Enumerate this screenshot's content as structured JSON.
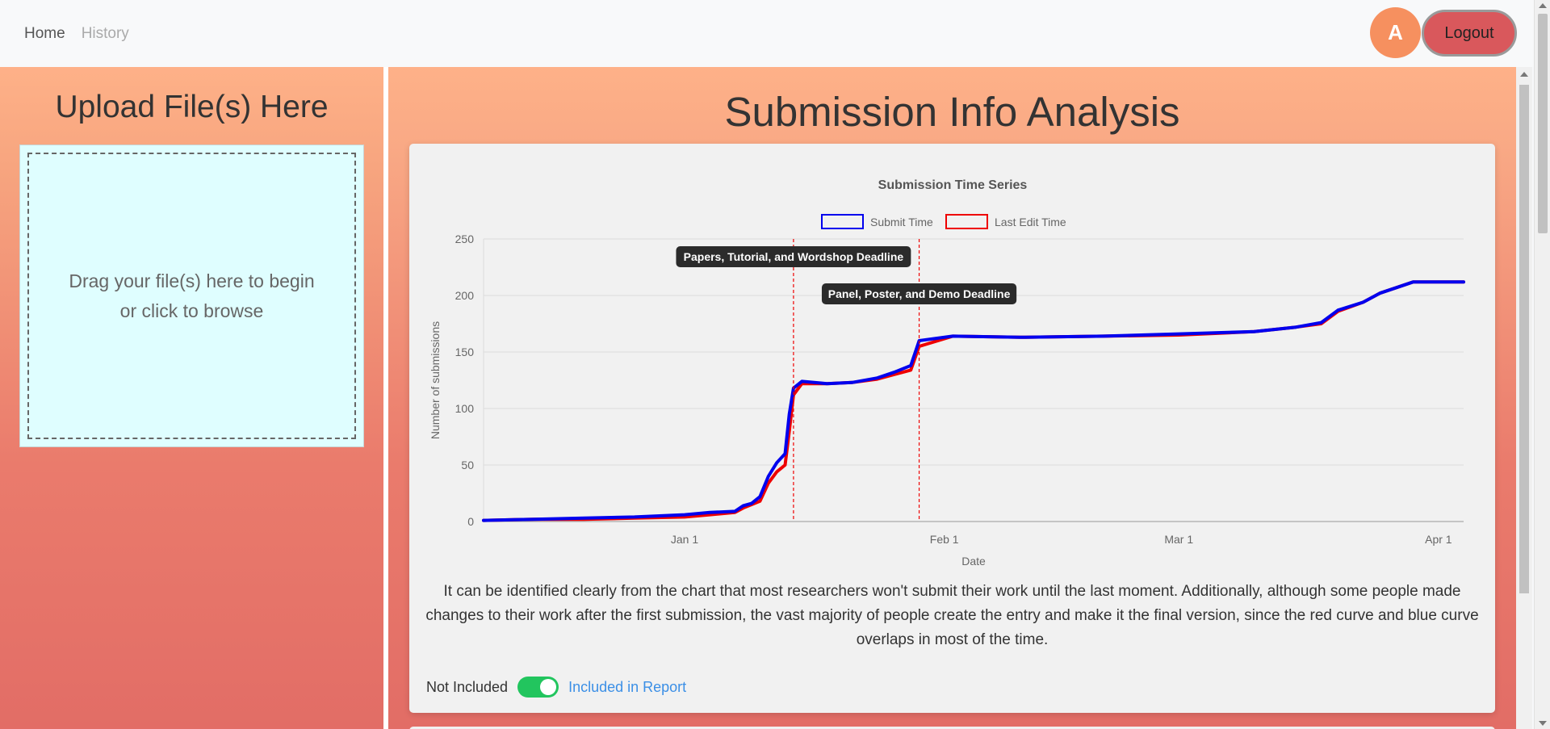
{
  "nav": {
    "home": "Home",
    "history": "History",
    "avatar_letter": "A",
    "logout": "Logout"
  },
  "upload": {
    "title": "Upload File(s) Here",
    "line1": "Drag your file(s) here to begin",
    "line2": "or click to browse"
  },
  "main": {
    "title": "Submission Info Analysis",
    "description": "It can be identified clearly from the chart that most researchers won't submit their work until the last moment. Additionally, although some people made changes to their work after the first submission, the vast majority of people create the entry and make it the final version, since the red curve and blue curve overlaps in most of the time.",
    "toggle_off_label": "Not Included",
    "toggle_on_label": "Included in Report",
    "toggle_state": true
  },
  "colors": {
    "submit": "#0000ee",
    "edit": "#ee0000",
    "accent": "#22c55e"
  },
  "chart_data": {
    "type": "line",
    "title": "Submission Time Series",
    "xlabel": "Date",
    "ylabel": "Number of submissions",
    "ylim": [
      0,
      250
    ],
    "yticks": [
      0,
      50,
      100,
      150,
      200,
      250
    ],
    "xlim": [
      "2022-12-08",
      "2023-04-04"
    ],
    "xticks": [
      {
        "date": "2023-01-01",
        "label": "Jan 1"
      },
      {
        "date": "2023-02-01",
        "label": "Feb 1"
      },
      {
        "date": "2023-03-01",
        "label": "Mar 1"
      },
      {
        "date": "2023-04-01",
        "label": "Apr 1"
      }
    ],
    "grid": true,
    "legend_position": "top-center",
    "annotations": [
      {
        "date": "2023-01-14",
        "label": "Papers, Tutorial, and Wordshop Deadline"
      },
      {
        "date": "2023-01-29",
        "label": "Panel, Poster, and Demo Deadline"
      }
    ],
    "series": [
      {
        "name": "Submit Time",
        "color": "#0000ee",
        "points": [
          [
            "2022-12-08",
            1
          ],
          [
            "2022-12-14",
            2
          ],
          [
            "2022-12-20",
            3
          ],
          [
            "2022-12-26",
            4
          ],
          [
            "2023-01-01",
            6
          ],
          [
            "2023-01-04",
            8
          ],
          [
            "2023-01-07",
            9
          ],
          [
            "2023-01-08",
            14
          ],
          [
            "2023-01-09",
            16
          ],
          [
            "2023-01-10",
            22
          ],
          [
            "2023-01-11",
            40
          ],
          [
            "2023-01-12",
            52
          ],
          [
            "2023-01-13",
            60
          ],
          [
            "2023-01-13.5",
            95
          ],
          [
            "2023-01-14",
            118
          ],
          [
            "2023-01-15",
            124
          ],
          [
            "2023-01-18",
            122
          ],
          [
            "2023-01-21",
            123
          ],
          [
            "2023-01-24",
            127
          ],
          [
            "2023-01-26",
            132
          ],
          [
            "2023-01-28",
            138
          ],
          [
            "2023-01-29",
            160
          ],
          [
            "2023-02-02",
            164
          ],
          [
            "2023-02-10",
            163
          ],
          [
            "2023-02-20",
            164
          ],
          [
            "2023-03-01",
            166
          ],
          [
            "2023-03-10",
            168
          ],
          [
            "2023-03-15",
            172
          ],
          [
            "2023-03-18",
            176
          ],
          [
            "2023-03-20",
            187
          ],
          [
            "2023-03-23",
            194
          ],
          [
            "2023-03-25",
            202
          ],
          [
            "2023-03-27",
            207
          ],
          [
            "2023-03-29",
            212
          ],
          [
            "2023-04-04",
            212
          ]
        ]
      },
      {
        "name": "Last Edit Time",
        "color": "#ee0000",
        "points": [
          [
            "2022-12-08",
            1
          ],
          [
            "2022-12-14",
            2
          ],
          [
            "2022-12-20",
            2
          ],
          [
            "2022-12-26",
            3
          ],
          [
            "2023-01-01",
            4
          ],
          [
            "2023-01-04",
            6
          ],
          [
            "2023-01-07",
            8
          ],
          [
            "2023-01-08",
            12
          ],
          [
            "2023-01-09",
            15
          ],
          [
            "2023-01-10",
            18
          ],
          [
            "2023-01-11",
            34
          ],
          [
            "2023-01-12",
            44
          ],
          [
            "2023-01-13",
            50
          ],
          [
            "2023-01-13.5",
            80
          ],
          [
            "2023-01-14",
            112
          ],
          [
            "2023-01-15",
            122
          ],
          [
            "2023-01-18",
            122
          ],
          [
            "2023-01-21",
            123
          ],
          [
            "2023-01-24",
            126
          ],
          [
            "2023-01-26",
            130
          ],
          [
            "2023-01-28",
            134
          ],
          [
            "2023-01-29",
            155
          ],
          [
            "2023-02-02",
            164
          ],
          [
            "2023-02-10",
            163
          ],
          [
            "2023-02-20",
            164
          ],
          [
            "2023-03-01",
            165
          ],
          [
            "2023-03-10",
            168
          ],
          [
            "2023-03-15",
            172
          ],
          [
            "2023-03-18",
            175
          ],
          [
            "2023-03-20",
            186
          ],
          [
            "2023-03-23",
            194
          ],
          [
            "2023-03-25",
            202
          ],
          [
            "2023-03-27",
            207
          ],
          [
            "2023-03-29",
            212
          ],
          [
            "2023-04-04",
            212
          ]
        ]
      }
    ]
  }
}
